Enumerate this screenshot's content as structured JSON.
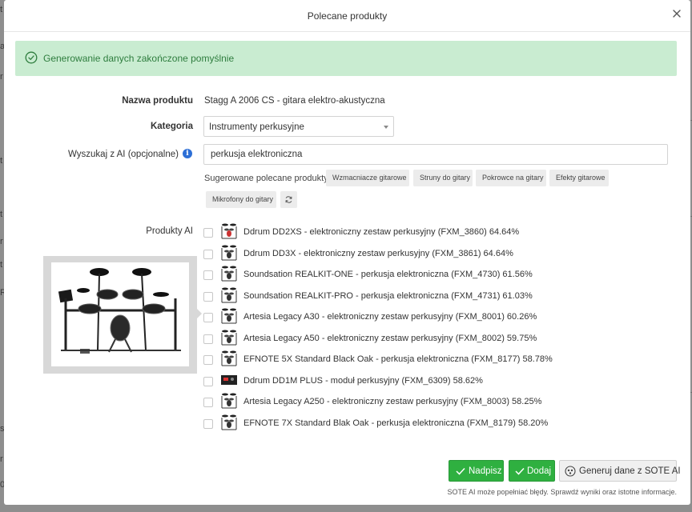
{
  "background": {
    "left_chars": [
      "t",
      "a",
      "r",
      "t",
      "t",
      "r",
      "t",
      "R",
      "s",
      "r",
      "0"
    ]
  },
  "modal": {
    "title": "Polecane produkty"
  },
  "alert": {
    "text": "Generowanie danych zakończone pomyślnie",
    "color": "#2e7d3e",
    "background": "#c9ecd1"
  },
  "form": {
    "product_name_label": "Nazwa produktu",
    "product_name_value": "Stagg A 2006 CS - gitara elektro-akustyczna",
    "category_label": "Kategoria",
    "category_value": "Instrumenty perkusyjne",
    "search_label": "Wyszukaj z AI (opcjonalne)",
    "search_value": "perkusja elektroniczna",
    "suggested_label": "Sugerowane polecane produkty:",
    "suggested_chips": [
      "Wzmacniacze gitarowe",
      "Struny do gitary",
      "Pokrowce na gitary",
      "Efekty gitarowe",
      "Mikrofony do gitary"
    ],
    "ai_products_label": "Produkty AI"
  },
  "products": [
    {
      "label": "Ddrum DD2XS - elektroniczny zestaw perkusyjny (FXM_3860)  64.64%",
      "checked": false
    },
    {
      "label": "Ddrum DD3X - elektroniczny zestaw perkusyjny (FXM_3861)  64.64%",
      "checked": false
    },
    {
      "label": "Soundsation REALKIT-ONE - perkusja elektroniczna (FXM_4730)  61.56%",
      "checked": false
    },
    {
      "label": "Soundsation REALKIT-PRO - perkusja elektroniczna (FXM_4731)  61.03%",
      "checked": false
    },
    {
      "label": "Artesia Legacy A30 - elektroniczny zestaw perkusyjny (FXM_8001)  60.26%",
      "checked": false
    },
    {
      "label": "Artesia Legacy A50 - elektroniczny zestaw perkusyjny (FXM_8002)  59.75%",
      "checked": false
    },
    {
      "label": "EFNOTE 5X Standard Black Oak - perkusja elektroniczna (FXM_8177)  58.78%",
      "checked": false
    },
    {
      "label": "Ddrum DD1M PLUS - moduł perkusyjny (FXM_6309)  58.62%",
      "checked": false
    },
    {
      "label": "Artesia Legacy A250 - elektroniczny zestaw perkusyjny (FXM_8003)  58.25%",
      "checked": false
    },
    {
      "label": "EFNOTE 7X Standard Blak Oak - perkusja elektroniczna (FXM_8179)  58.20%",
      "checked": false
    }
  ],
  "buttons": {
    "overwrite": "Nadpisz",
    "add": "Dodaj",
    "generate": "Generuj dane z SOTE AI"
  },
  "footer_note": "SOTE AI może popełniać błędy. Sprawdź wyniki oraz istotne informacje.",
  "colors": {
    "accent_green": "#2fb040",
    "info_blue": "#2d6fd6"
  }
}
